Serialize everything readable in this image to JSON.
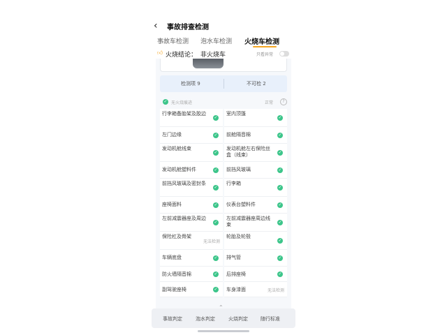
{
  "header": {
    "title": "事故排查检测",
    "back_icon": "chevron-left-icon"
  },
  "tabs": [
    {
      "label": "事故车检测",
      "active": false
    },
    {
      "label": "泡水车检测",
      "active": false
    },
    {
      "label": "火烧车检测",
      "active": true
    }
  ],
  "verdict": {
    "icon": "thumbs-up-icon",
    "label": "火烧结论：",
    "value": "非火烧车",
    "toggle_label": "只看异常",
    "toggle_on": false
  },
  "summary": {
    "normal": "检测项 9",
    "abnormal": "不可检 2"
  },
  "section": {
    "title": "无火烧痕迹",
    "right_text": "正常"
  },
  "items": [
    {
      "label": "行李箱备胎架及胶边",
      "status": "ok",
      "note": ""
    },
    {
      "label": "室内顶篷",
      "status": "ok",
      "note": ""
    },
    {
      "label": "左门边缘",
      "status": "ok",
      "note": ""
    },
    {
      "label": "前舱隔音棉",
      "status": "ok",
      "note": ""
    },
    {
      "label": "发动机舱线束",
      "status": "ok",
      "note": ""
    },
    {
      "label": "发动机舱左右保险丝盒（线束）",
      "status": "ok",
      "note": ""
    },
    {
      "label": "发动机舱塑料件",
      "status": "ok",
      "note": ""
    },
    {
      "label": "前挡风玻璃",
      "status": "ok",
      "note": ""
    },
    {
      "label": "前挡风玻璃及密封条",
      "status": "ok",
      "note": ""
    },
    {
      "label": "行李箱",
      "status": "ok",
      "note": ""
    },
    {
      "label": "座椅面料",
      "status": "ok",
      "note": ""
    },
    {
      "label": "仪表台塑料件",
      "status": "ok",
      "note": ""
    },
    {
      "label": "左前减震器座及周边",
      "status": "ok",
      "note": ""
    },
    {
      "label": "左前减震器座周边线束",
      "status": "ok",
      "note": ""
    },
    {
      "label": "保险杠及骨架",
      "status": "na",
      "note": "无法检测"
    },
    {
      "label": "轮胎及轮毂",
      "status": "ok",
      "note": ""
    },
    {
      "label": "车辆底盘",
      "status": "ok",
      "note": ""
    },
    {
      "label": "排气管",
      "status": "ok",
      "note": ""
    },
    {
      "label": "防火墙隔音棉",
      "status": "ok",
      "note": ""
    },
    {
      "label": "后排座椅",
      "status": "ok",
      "note": ""
    },
    {
      "label": "副驾驶座椅",
      "status": "ok",
      "note": ""
    },
    {
      "label": "车身漆面",
      "status": "na",
      "note": "无法检测"
    }
  ],
  "bottom_tabs": [
    "事故判定",
    "泡水判定",
    "火烧判定",
    "随行标准"
  ],
  "colors": {
    "accent": "#f5a623",
    "ok": "#3cc58a"
  }
}
